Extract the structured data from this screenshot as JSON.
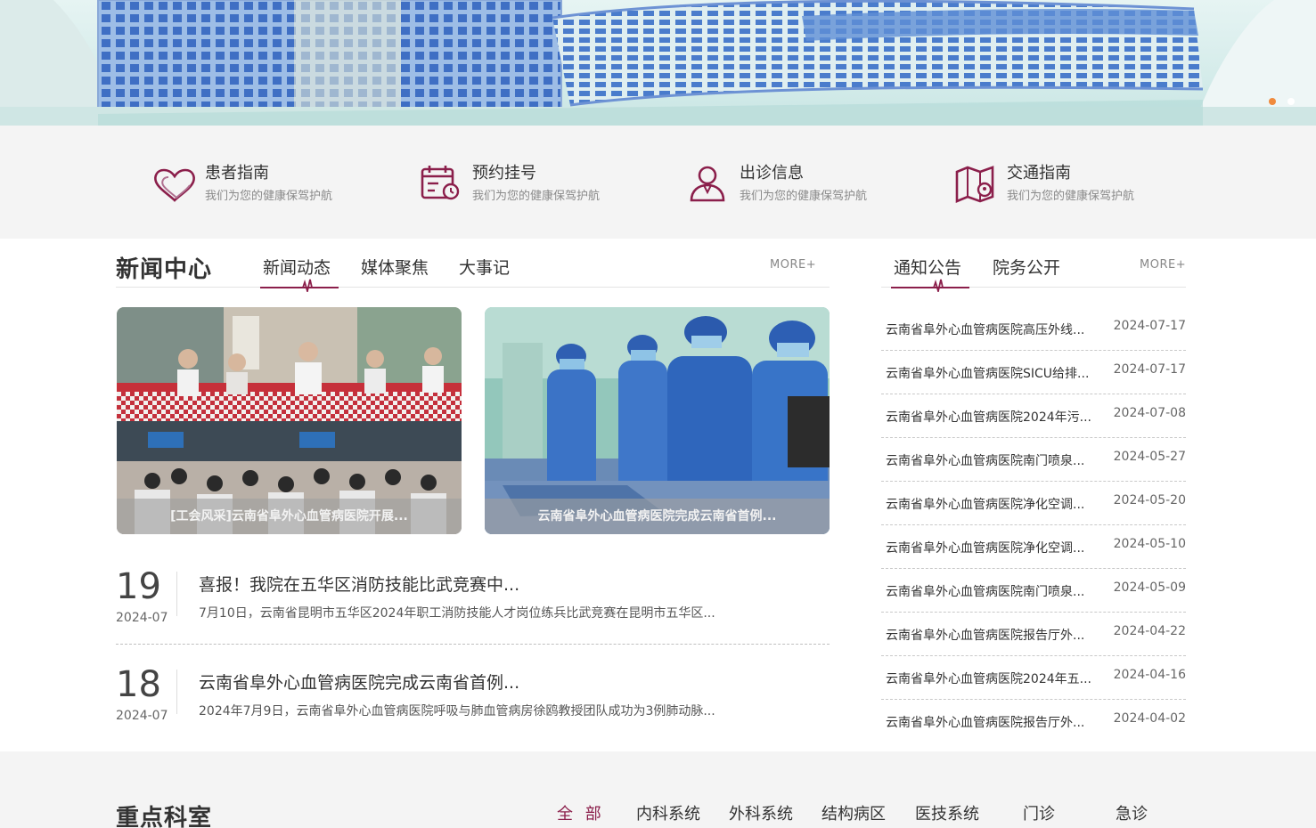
{
  "banner": {
    "slides_active": 1
  },
  "quick_links": [
    {
      "title": "患者指南",
      "subtitle": "我们为您的健康保驾护航",
      "icon": "heart-icon"
    },
    {
      "title": "预约挂号",
      "subtitle": "我们为您的健康保驾护航",
      "icon": "calendar-icon"
    },
    {
      "title": "出诊信息",
      "subtitle": "我们为您的健康保驾护航",
      "icon": "doctor-icon"
    },
    {
      "title": "交通指南",
      "subtitle": "我们为您的健康保驾护航",
      "icon": "map-icon"
    }
  ],
  "news": {
    "section_title": "新闻中心",
    "tabs": [
      "新闻动态",
      "媒体聚焦",
      "大事记"
    ],
    "more": "MORE+",
    "photos": [
      {
        "caption": "[工会风采]云南省阜外心血管病医院开展..."
      },
      {
        "caption": "云南省阜外心血管病医院完成云南省首例..."
      }
    ],
    "items": [
      {
        "day": "19",
        "ym": "2024-07",
        "title": "喜报！我院在五华区消防技能比武竞赛中...",
        "summary": "7月10日，云南省昆明市五华区2024年职工消防技能人才岗位练兵比武竞赛在昆明市五华区..."
      },
      {
        "day": "18",
        "ym": "2024-07",
        "title": "云南省阜外心血管病医院完成云南省首例...",
        "summary": "2024年7月9日，云南省阜外心血管病医院呼吸与肺血管病房徐鸥教授团队成功为3例肺动脉..."
      }
    ]
  },
  "notices": {
    "tabs": [
      "通知公告",
      "院务公开"
    ],
    "more": "MORE+",
    "items": [
      {
        "title": "云南省阜外心血管病医院高压外线...",
        "date": "2024-07-17"
      },
      {
        "title": "云南省阜外心血管病医院SICU给排...",
        "date": "2024-07-17"
      },
      {
        "title": "云南省阜外心血管病医院2024年污...",
        "date": "2024-07-08"
      },
      {
        "title": "云南省阜外心血管病医院南门喷泉...",
        "date": "2024-05-27"
      },
      {
        "title": "云南省阜外心血管病医院净化空调...",
        "date": "2024-05-20"
      },
      {
        "title": "云南省阜外心血管病医院净化空调...",
        "date": "2024-05-10"
      },
      {
        "title": "云南省阜外心血管病医院南门喷泉...",
        "date": "2024-05-09"
      },
      {
        "title": "云南省阜外心血管病医院报告厅外...",
        "date": "2024-04-22"
      },
      {
        "title": "云南省阜外心血管病医院2024年五...",
        "date": "2024-04-16"
      },
      {
        "title": "云南省阜外心血管病医院报告厅外...",
        "date": "2024-04-02"
      }
    ]
  },
  "departments": {
    "section_title": "重点科室",
    "tabs": [
      "全 部",
      "内科系统",
      "外科系统",
      "结构病区",
      "医技系统",
      "门诊",
      "急诊"
    ]
  },
  "colors": {
    "accent": "#8b1f4b",
    "dot_active": "#f08a3c"
  }
}
